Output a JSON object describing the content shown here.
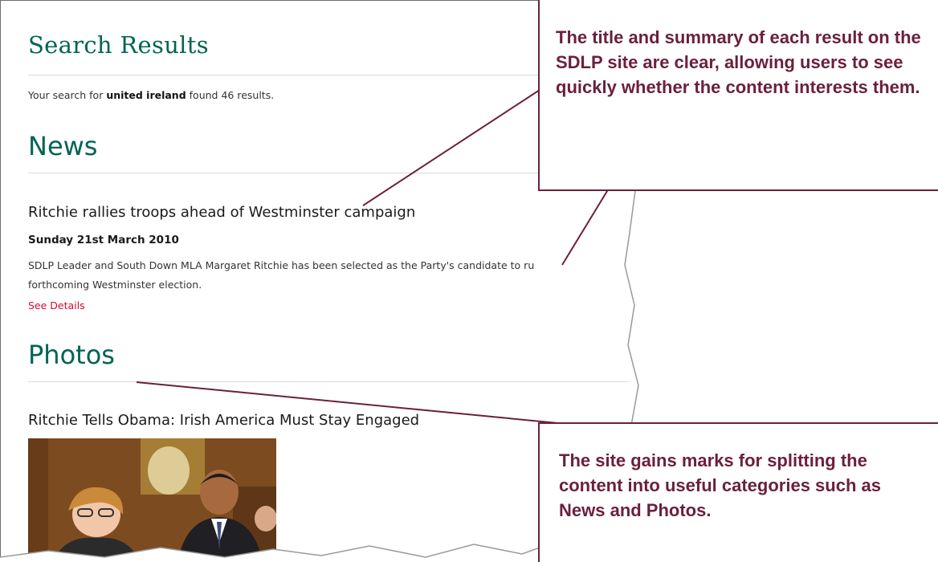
{
  "page": {
    "title": "Search Results",
    "summary": {
      "prefix": "Your search for ",
      "query": "united ireland",
      "middle": " found ",
      "count": "46",
      "suffix": " results."
    }
  },
  "sections": {
    "news": {
      "heading": "News",
      "item": {
        "title": "Ritchie rallies troops ahead of Westminster campaign",
        "date": "Sunday 21st March 2010",
        "summary_line1": "SDLP Leader and South Down MLA Margaret Ritchie has been selected as the Party's candidate to ru",
        "summary_line2": "forthcoming Westminster election.",
        "link": "See Details"
      }
    },
    "photos": {
      "heading": "Photos",
      "item": {
        "title": "Ritchie Tells Obama: Irish America Must Stay Engaged"
      }
    }
  },
  "callouts": [
    {
      "text": "The title and summary of each result on the SDLP site are clear, allowing users to see quickly whether the content interests them."
    },
    {
      "text": "The site gains marks for splitting the content into useful categories such as News and Photos."
    }
  ],
  "colors": {
    "heading": "#006454",
    "link": "#c8102e",
    "callout": "#6b1f3e"
  }
}
